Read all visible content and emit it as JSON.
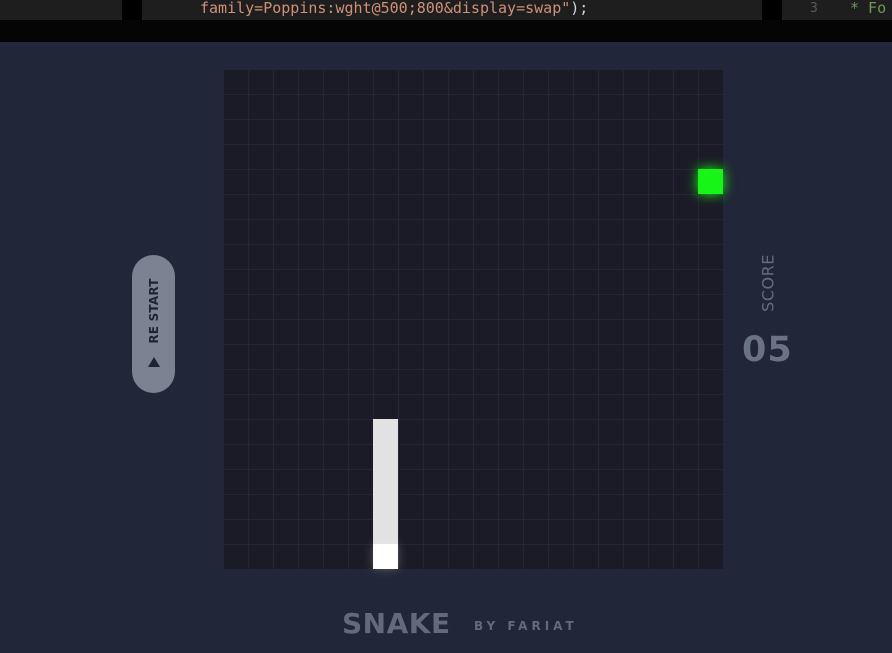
{
  "editor": {
    "code_text": "family=Poppins:wght@500;800&display=swap\"",
    "code_tail": ");",
    "line_number": "3",
    "comment_text": "* Fo"
  },
  "game": {
    "grid_cells": 20,
    "food": {
      "col": 19,
      "row": 4
    },
    "snake": [
      {
        "col": 6,
        "row": 14
      },
      {
        "col": 6,
        "row": 15
      },
      {
        "col": 6,
        "row": 16
      },
      {
        "col": 6,
        "row": 17
      },
      {
        "col": 6,
        "row": 18
      },
      {
        "col": 6,
        "row": 19
      }
    ],
    "snake_head_index": 5
  },
  "restart": {
    "label": "RE START"
  },
  "score": {
    "label": "SCORE",
    "value": "05"
  },
  "footer": {
    "title": "SNAKE",
    "byline": "BY FARIAT"
  },
  "colors": {
    "background": "#212638",
    "board": "#1b1b27",
    "food": "#16f516",
    "snake_body": "#e2e2e2",
    "snake_head": "#ffffff",
    "restart_button": "#7b8292",
    "text_muted": "#646c7e"
  }
}
